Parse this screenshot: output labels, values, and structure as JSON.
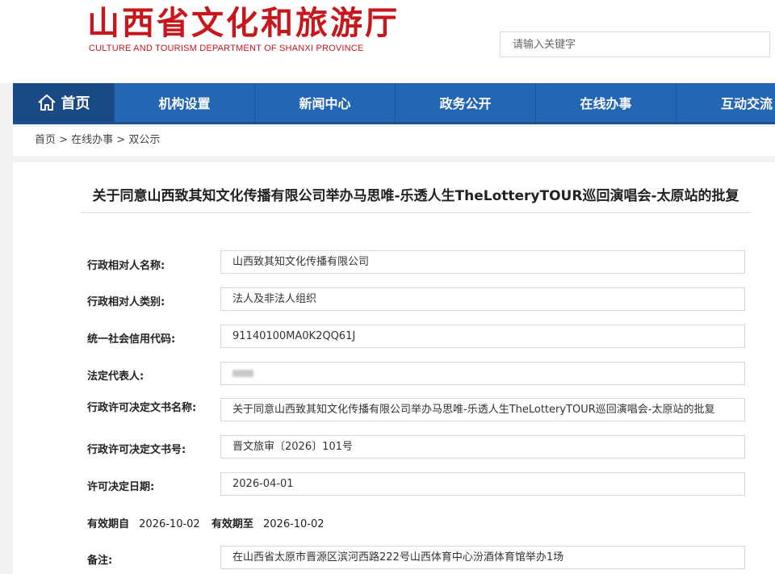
{
  "header": {
    "logo_cn": "山西省文化和旅游厅",
    "logo_en": "CULTURE AND TOURISM DEPARTMENT OF SHANXI PROVINCE",
    "search_placeholder": "请输入关键字"
  },
  "nav": {
    "home": "首页",
    "items": [
      "机构设置",
      "新闻中心",
      "政务公开",
      "在线办事",
      "互动交流"
    ]
  },
  "breadcrumb": "首页 > 在线办事 > 双公示",
  "doc": {
    "title": "关于同意山西致其知文化传播有限公司举办马思唯-乐透人生TheLotteryTOUR巡回演唱会-太原站的批复",
    "fields": [
      {
        "label": "行政相对人名称:",
        "value": "山西致其知文化传播有限公司"
      },
      {
        "label": "行政相对人类别:",
        "value": "法人及非法人组织"
      },
      {
        "label": "统一社会信用代码:",
        "value": "91140100MA0K2QQ61J"
      },
      {
        "label": "法定代表人:",
        "value": ""
      },
      {
        "label": "行政许可决定文书名称:",
        "value": "关于同意山西致其知文化传播有限公司举办马思唯-乐透人生TheLotteryTOUR巡回演唱会-太原站的批复"
      },
      {
        "label": "行政许可决定文书号:",
        "value": "晋文旅审〔2026〕101号"
      },
      {
        "label": "许可决定日期:",
        "value": "2026-04-01"
      }
    ],
    "validity": {
      "from_label": "有效期自",
      "from": "2026-10-02",
      "to_label": "有效期至",
      "to": "2026-10-02"
    },
    "remark": {
      "label": "备注:",
      "value": "在山西省太原市晋源区滨河西路222号山西体育中心汾酒体育馆举办1场"
    }
  }
}
